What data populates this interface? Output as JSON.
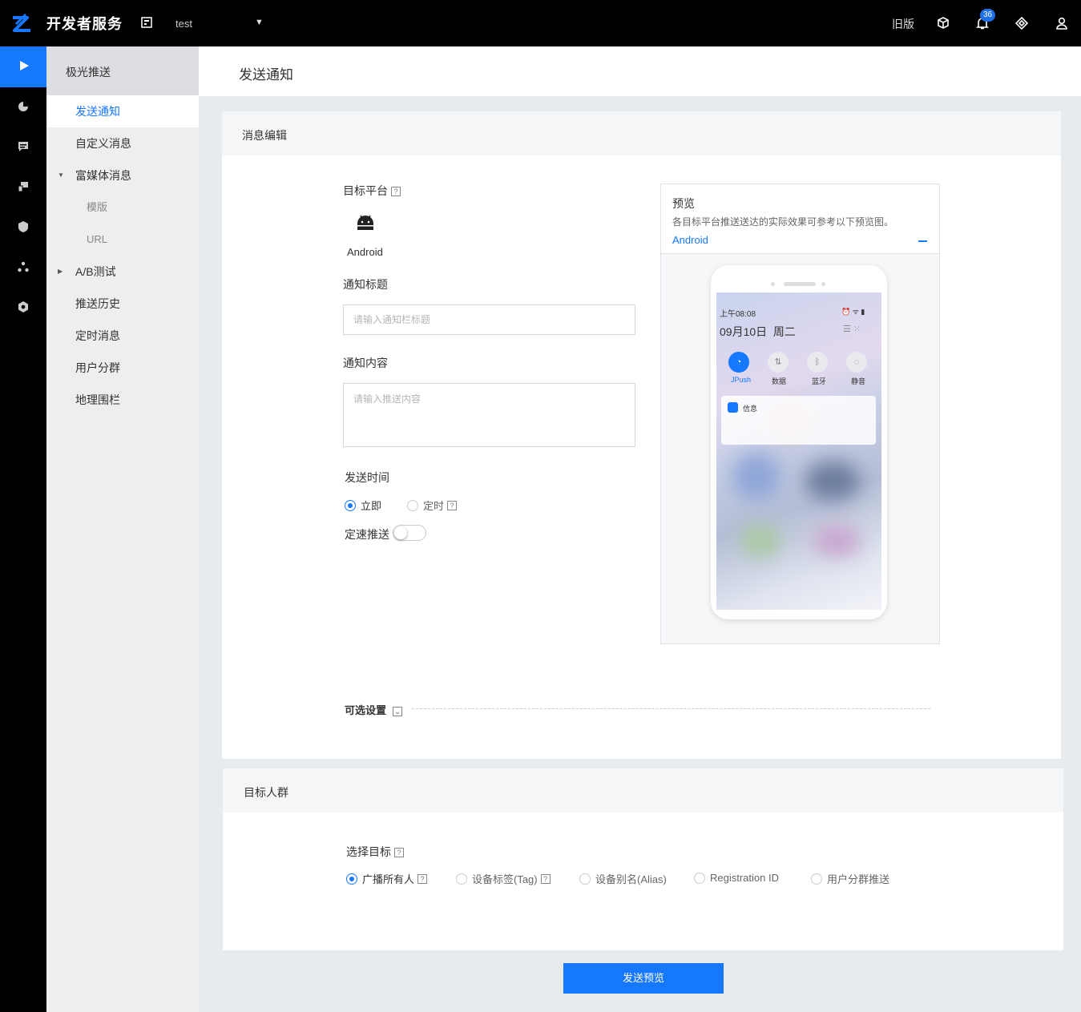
{
  "topbar": {
    "brand": "开发者服务",
    "app_name": "test",
    "old_version": "旧版",
    "notification_count": "36"
  },
  "subnav": {
    "header": "极光推送",
    "items": [
      {
        "label": "发送通知"
      },
      {
        "label": "自定义消息"
      },
      {
        "label": "富媒体消息"
      },
      {
        "label": "模版"
      },
      {
        "label": "URL"
      },
      {
        "label": "A/B测试"
      },
      {
        "label": "推送历史"
      },
      {
        "label": "定时消息"
      },
      {
        "label": "用户分群"
      },
      {
        "label": "地理围栏"
      }
    ]
  },
  "page": {
    "title": "发送通知"
  },
  "message_edit": {
    "section_title": "消息编辑",
    "target_platform_label": "目标平台",
    "platform_name": "Android",
    "title_label": "通知标题",
    "title_placeholder": "请输入通知栏标题",
    "content_label": "通知内容",
    "content_placeholder": "请输入推送内容",
    "send_time_label": "发送时间",
    "send_now": "立即",
    "send_scheduled": "定时",
    "rate_push_label": "定速推送",
    "optional_settings": "可选设置"
  },
  "preview": {
    "title": "预览",
    "description": "各目标平台推送送达的实际效果可参考以下预览图。",
    "platform_tab": "Android",
    "phone_time": "上午08:08",
    "phone_date": "09月10日  周二",
    "qs": [
      {
        "label": "JPush"
      },
      {
        "label": "数据"
      },
      {
        "label": "蓝牙"
      },
      {
        "label": "静音"
      }
    ],
    "notif_app": "信息"
  },
  "target_audience": {
    "section_title": "目标人群",
    "select_label": "选择目标",
    "options": [
      {
        "label": "广播所有人"
      },
      {
        "label": "设备标签(Tag)"
      },
      {
        "label": "设备别名(Alias)"
      },
      {
        "label": "Registration ID"
      },
      {
        "label": "用户分群推送"
      }
    ]
  },
  "actions": {
    "send_preview": "发送预览"
  },
  "colors": {
    "accent": "#1677ff",
    "topbar": "#000000"
  }
}
